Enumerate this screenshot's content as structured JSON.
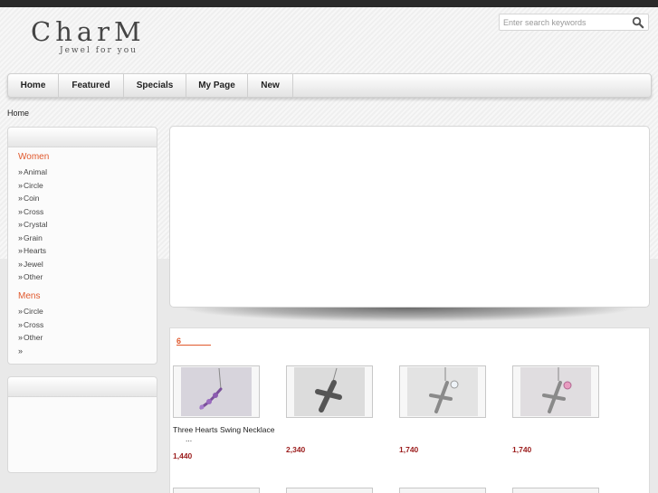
{
  "header": {
    "logo_title": "CharM",
    "logo_tagline": "Jewel for you",
    "search_placeholder": "Enter search keywords"
  },
  "nav": {
    "items": [
      {
        "label": "Home"
      },
      {
        "label": "Featured"
      },
      {
        "label": "Specials"
      },
      {
        "label": "My Page"
      },
      {
        "label": "New"
      }
    ]
  },
  "breadcrumb": "Home",
  "sidebar": {
    "women": {
      "heading": "Women",
      "items": [
        "Animal",
        "Circle",
        "Coin",
        "Cross",
        "Crystal",
        "Grain",
        "Hearts",
        "Jewel",
        "Other"
      ]
    },
    "mens": {
      "heading": "Mens",
      "items": [
        "Circle",
        "Cross",
        "Other",
        ""
      ]
    }
  },
  "products": {
    "count_label": "6",
    "items": [
      {
        "name": "Three Hearts Swing Necklace",
        "name_cont": "...",
        "price": "1,440"
      },
      {
        "name": "",
        "price": "2,340"
      },
      {
        "name": "",
        "price": "1,740"
      },
      {
        "name": "",
        "price": "1,740"
      }
    ]
  },
  "colors": {
    "accent": "#e0582c",
    "price": "#9b1c1c",
    "topbar": "#2a2a2a"
  }
}
